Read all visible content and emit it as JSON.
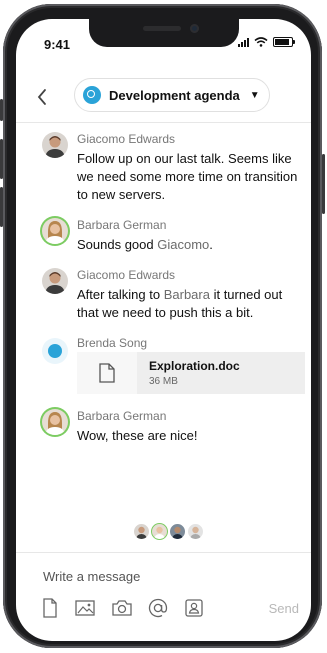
{
  "status": {
    "time": "9:41"
  },
  "header": {
    "back_icon": "chevron-left-icon",
    "channel_name": "Development agenda",
    "dropdown_icon": "caret-down-icon"
  },
  "messages": [
    {
      "author": "Giacomo Edwards",
      "text": "Follow up on our last talk. Seems like we need some more time on transition to new servers."
    },
    {
      "author": "Barbara German",
      "text_before": "Sounds good ",
      "mention": "Giacomo",
      "text_after": "."
    },
    {
      "author": "Giacomo Edwards",
      "text_before": "After talking to ",
      "mention": "Barbara",
      "text_after": " it turned out that we need to push this a bit."
    },
    {
      "author": "Brenda Song",
      "file": {
        "name": "Exploration.doc",
        "size": "36 MB"
      }
    },
    {
      "author": "Barbara German",
      "text": "Wow, these are nice!"
    }
  ],
  "composer": {
    "placeholder": "Write a message",
    "send_label": "Send",
    "tools": [
      "document-icon",
      "image-icon",
      "camera-icon",
      "at-icon",
      "contact-icon"
    ]
  },
  "colors": {
    "accent": "#2aa3d8",
    "online_ring": "#7ccc62",
    "muted": "#777777"
  }
}
